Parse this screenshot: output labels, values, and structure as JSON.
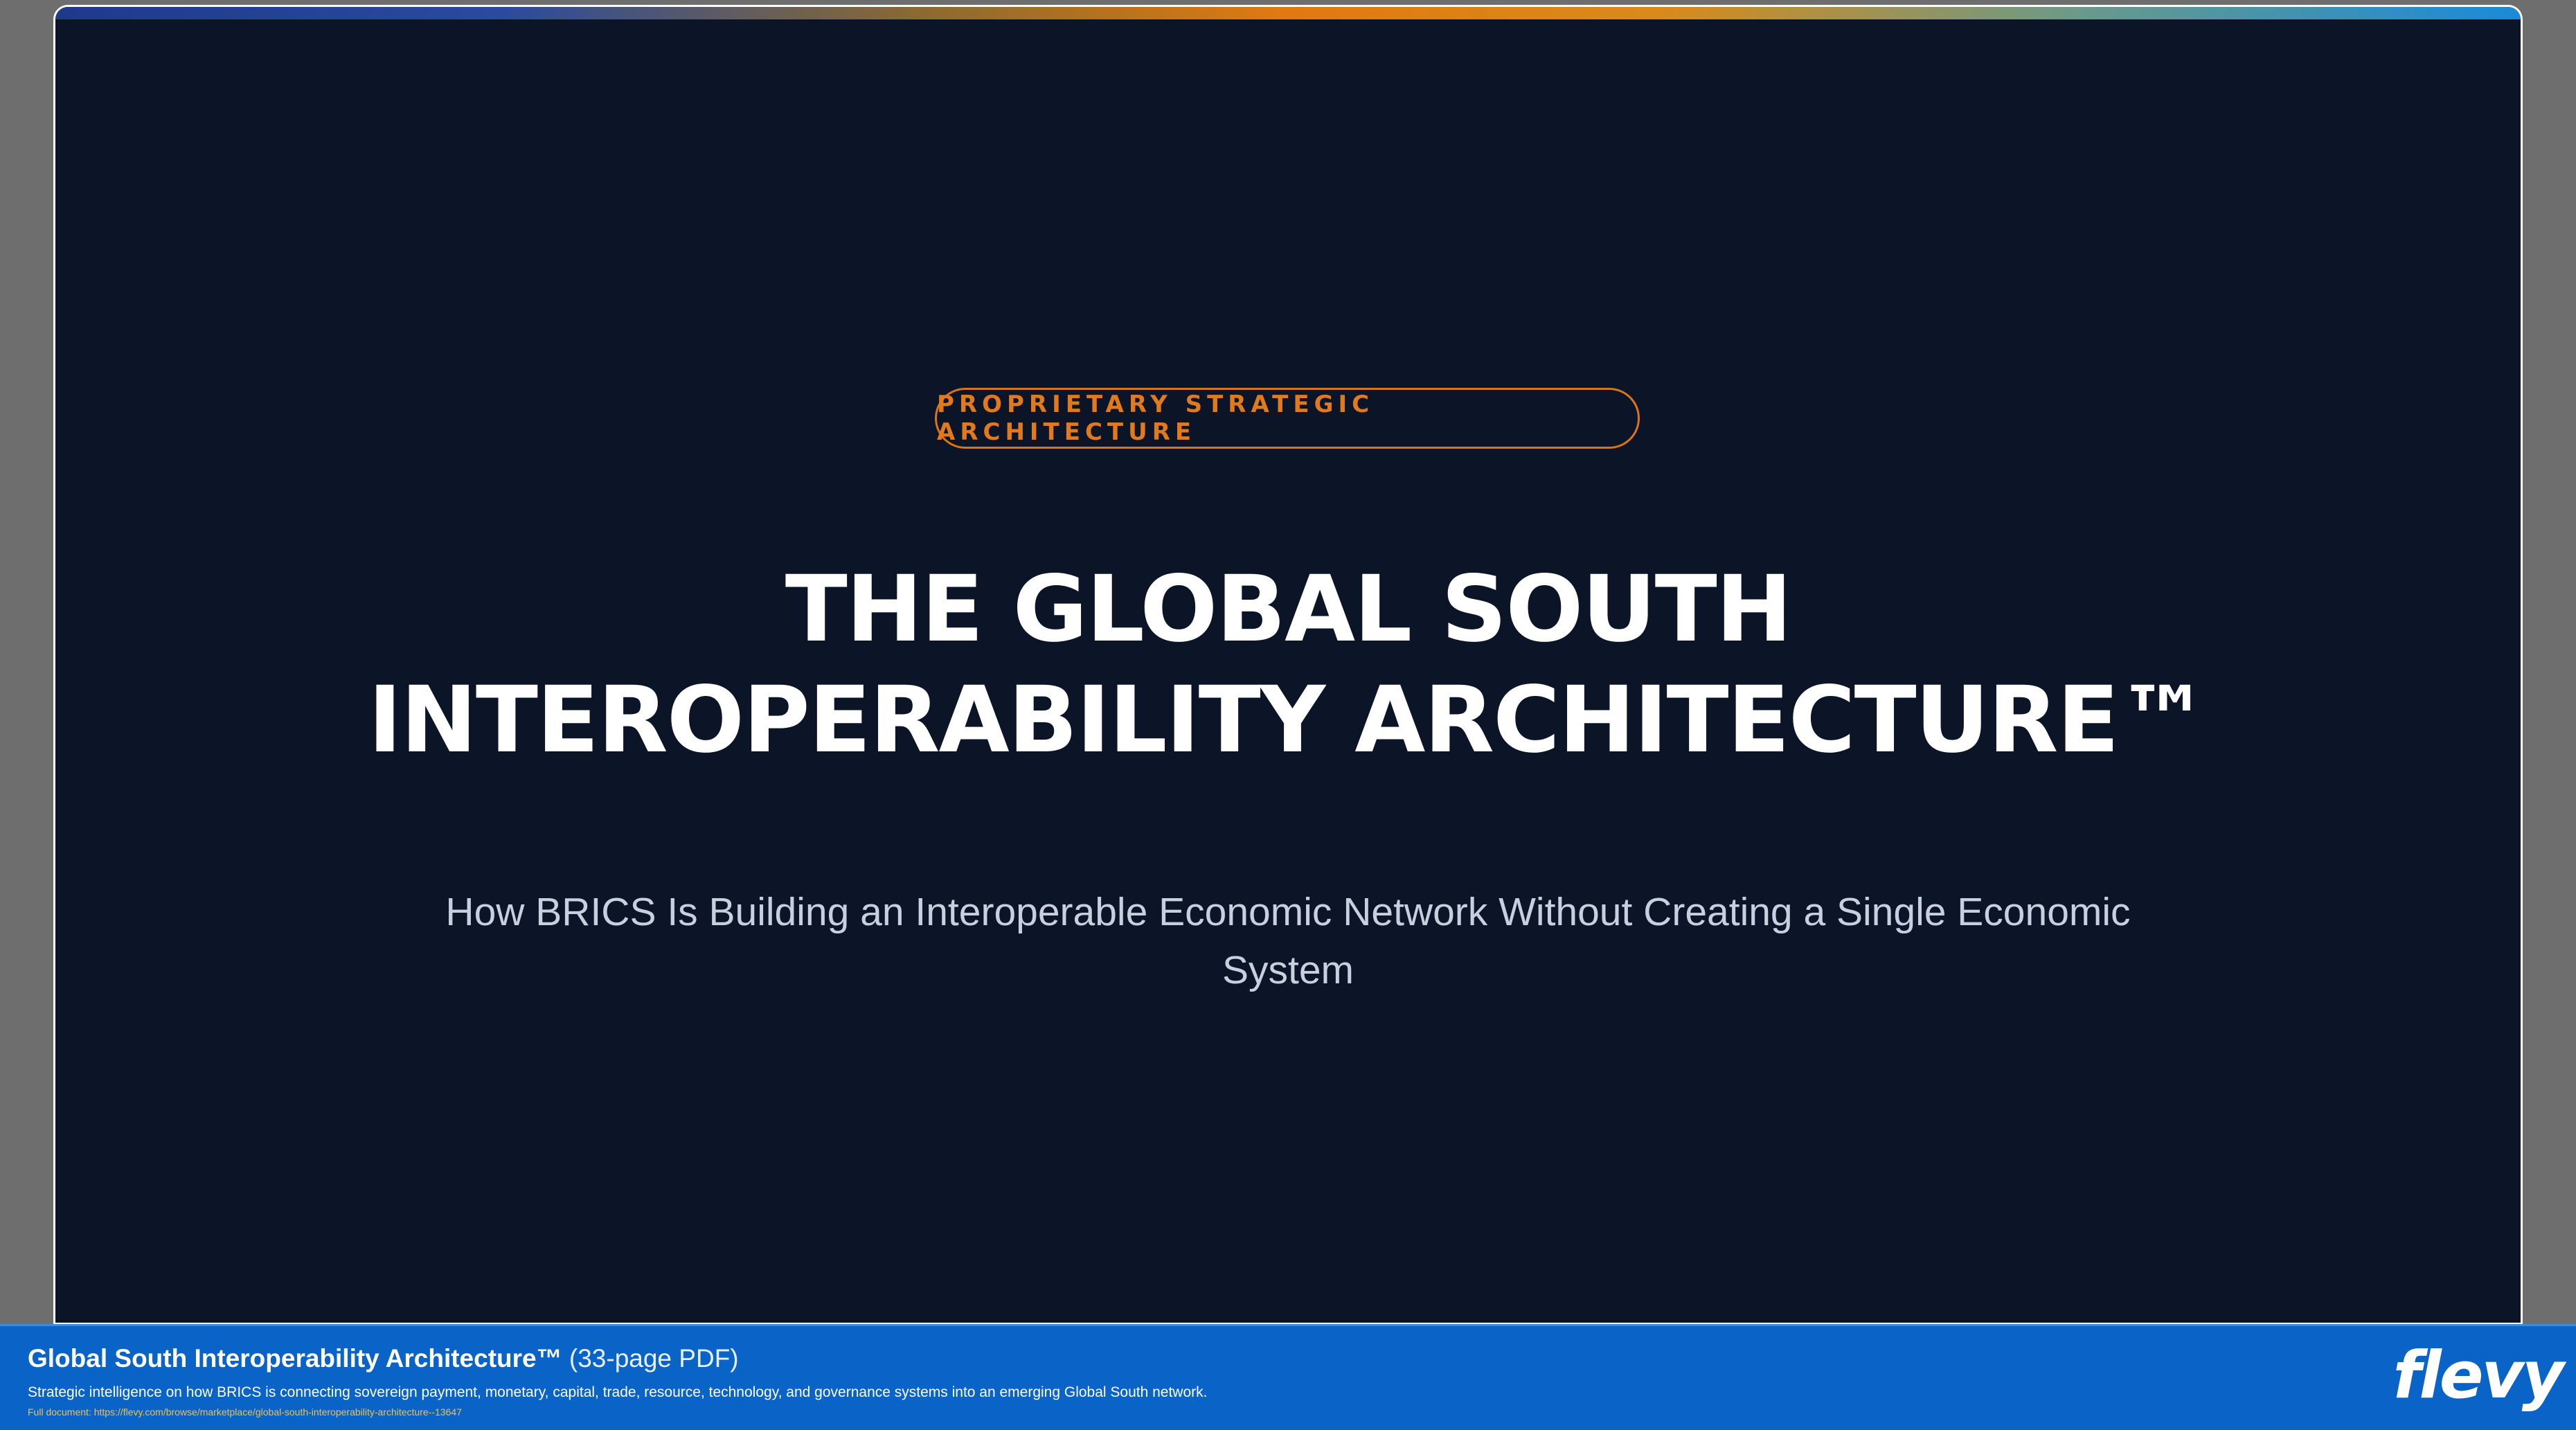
{
  "slide": {
    "badge": "PROPRIETARY STRATEGIC ARCHITECTURE",
    "title_lines": [
      "THE GLOBAL SOUTH",
      "INTEROPERABILITY ARCHITECTURE™"
    ],
    "subtitle": "How BRICS Is Building an Interoperable Economic Network Without Creating a Single Economic System"
  },
  "footer": {
    "title": "Global South Interoperability Architecture™",
    "pages": "(33-page PDF)",
    "description": "Strategic intelligence on how BRICS is connecting sovereign payment, monetary, capital, trade, resource, technology, and governance systems into an emerging Global South network.",
    "url": "Full document: https://flevy.com/browse/marketplace/global-south-interoperability-architecture--13647",
    "logo": "flevy"
  },
  "colors": {
    "slide_background": "#0c1428",
    "accent": "#e07a1c",
    "footer_background": "#0a64c8",
    "link": "#f0c24a"
  }
}
